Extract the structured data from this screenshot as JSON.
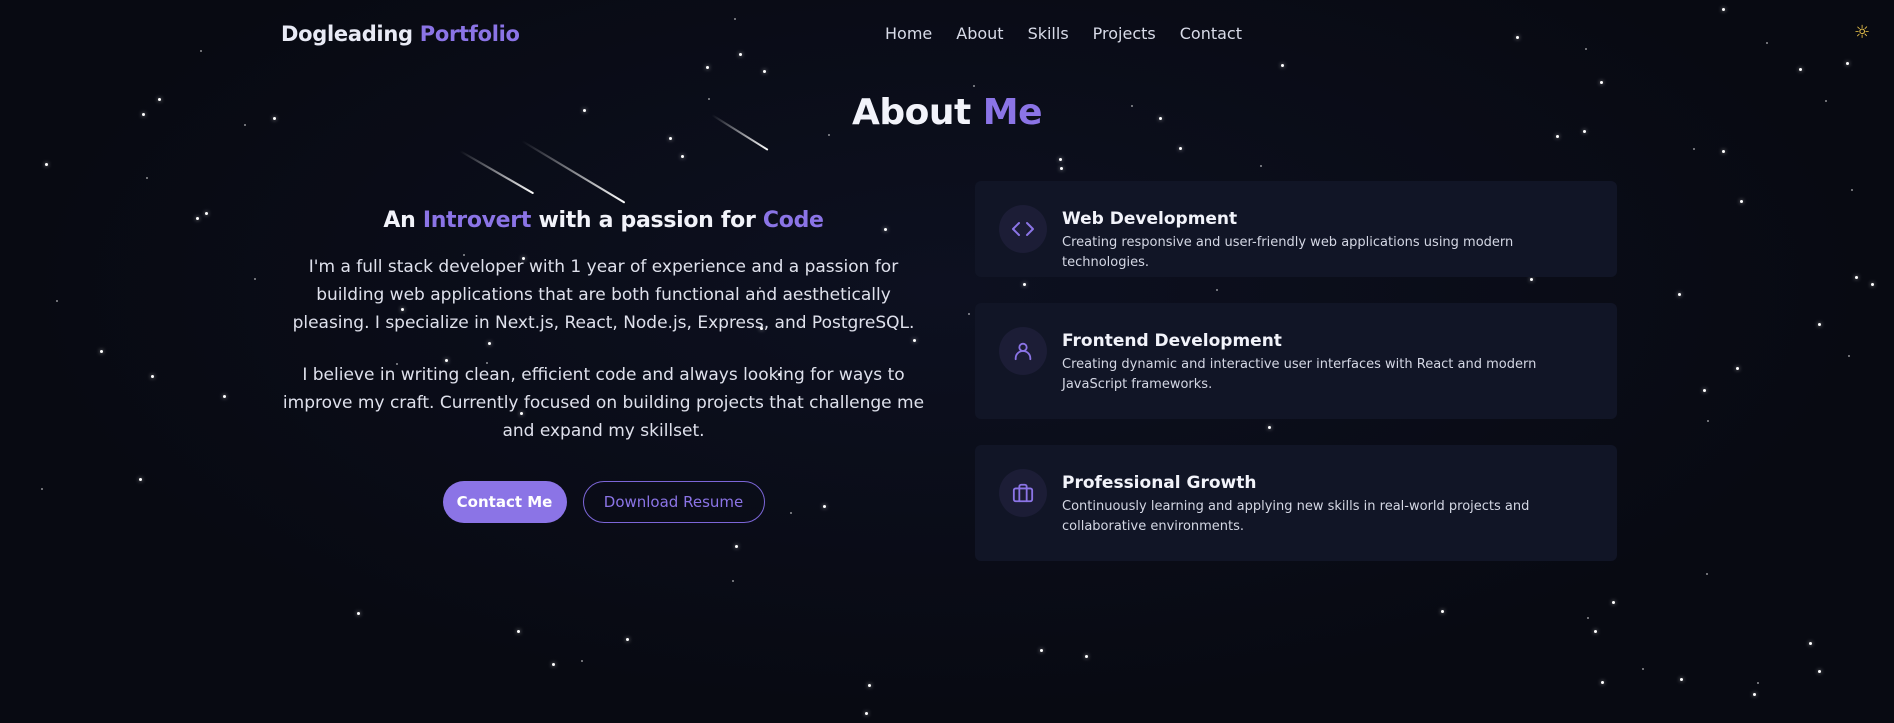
{
  "brand": {
    "part1": "Dogleading",
    "part2": "Portfolio"
  },
  "nav": {
    "items": [
      "Home",
      "About",
      "Skills",
      "Projects",
      "Contact"
    ],
    "theme_icon": "sun-icon"
  },
  "section_title": {
    "part1": "About",
    "part2": "Me"
  },
  "intro": {
    "tagline": {
      "w1": "An",
      "w2": "Introvert",
      "w3": "with a passion for",
      "w4": "Code"
    },
    "paragraph1": "I'm a full stack developer with 1 year of experience and a passion for building web applications that are both functional and aesthetically pleasing. I specialize in Next.js, React, Node.js, Express, and PostgreSQL.",
    "paragraph2": "I believe in writing clean, efficient code and always looking for ways to improve my craft. Currently focused on building projects that challenge me and expand my skillset.",
    "primary_button": "Contact Me",
    "secondary_button": "Download Resume"
  },
  "cards": [
    {
      "icon": "code-icon",
      "title": "Web Development",
      "desc": "Creating responsive and user-friendly web applications using modern technologies."
    },
    {
      "icon": "user-icon",
      "title": "Frontend Development",
      "desc": "Creating dynamic and interactive user interfaces with React and modern JavaScript frameworks."
    },
    {
      "icon": "briefcase-icon",
      "title": "Professional Growth",
      "desc": "Continuously learning and applying new skills in real-world projects and collaborative environments."
    }
  ],
  "colors": {
    "accent": "#8b74e6",
    "background": "#0a0c16",
    "card": "#111526",
    "sun": "#f2c94c"
  }
}
